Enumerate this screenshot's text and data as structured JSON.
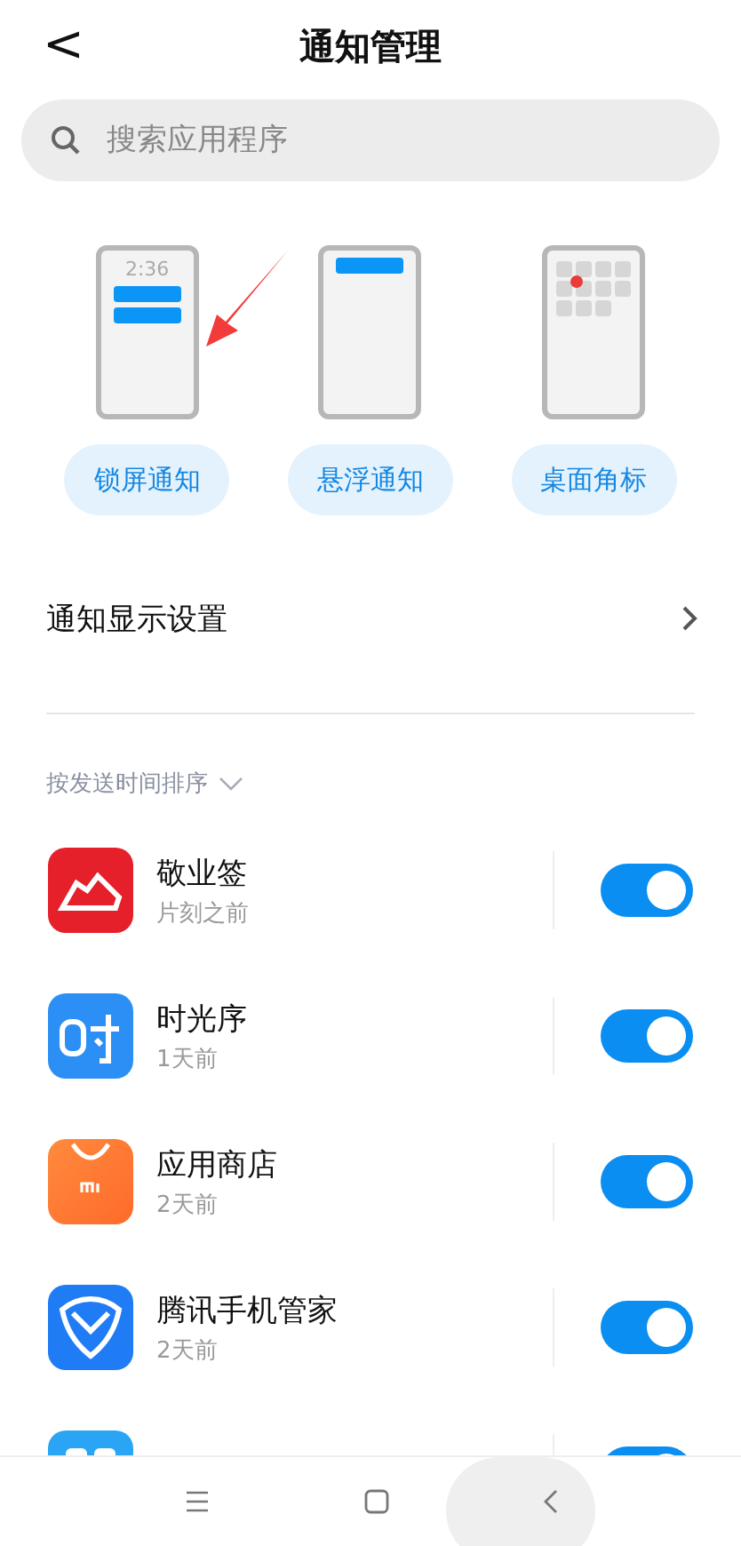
{
  "header": {
    "back": "<",
    "title": "通知管理"
  },
  "search": {
    "placeholder": "搜索应用程序"
  },
  "styles": [
    {
      "kind": "lockscreen",
      "time": "2:36",
      "label": "锁屏通知"
    },
    {
      "kind": "floating",
      "label": "悬浮通知"
    },
    {
      "kind": "badge",
      "label": "桌面角标"
    }
  ],
  "display_settings": {
    "label": "通知显示设置"
  },
  "sort": {
    "label": "按发送时间排序"
  },
  "apps": [
    {
      "kind": "jingye",
      "name": "敬业签",
      "time": "片刻之前",
      "on": true
    },
    {
      "kind": "shiguang",
      "name": "时光序",
      "time": "1天前",
      "on": true
    },
    {
      "kind": "store",
      "name": "应用商店",
      "time": "2天前",
      "on": true
    },
    {
      "kind": "tencent",
      "name": "腾讯手机管家",
      "time": "2天前",
      "on": true
    },
    {
      "kind": "partial",
      "on": true
    }
  ]
}
